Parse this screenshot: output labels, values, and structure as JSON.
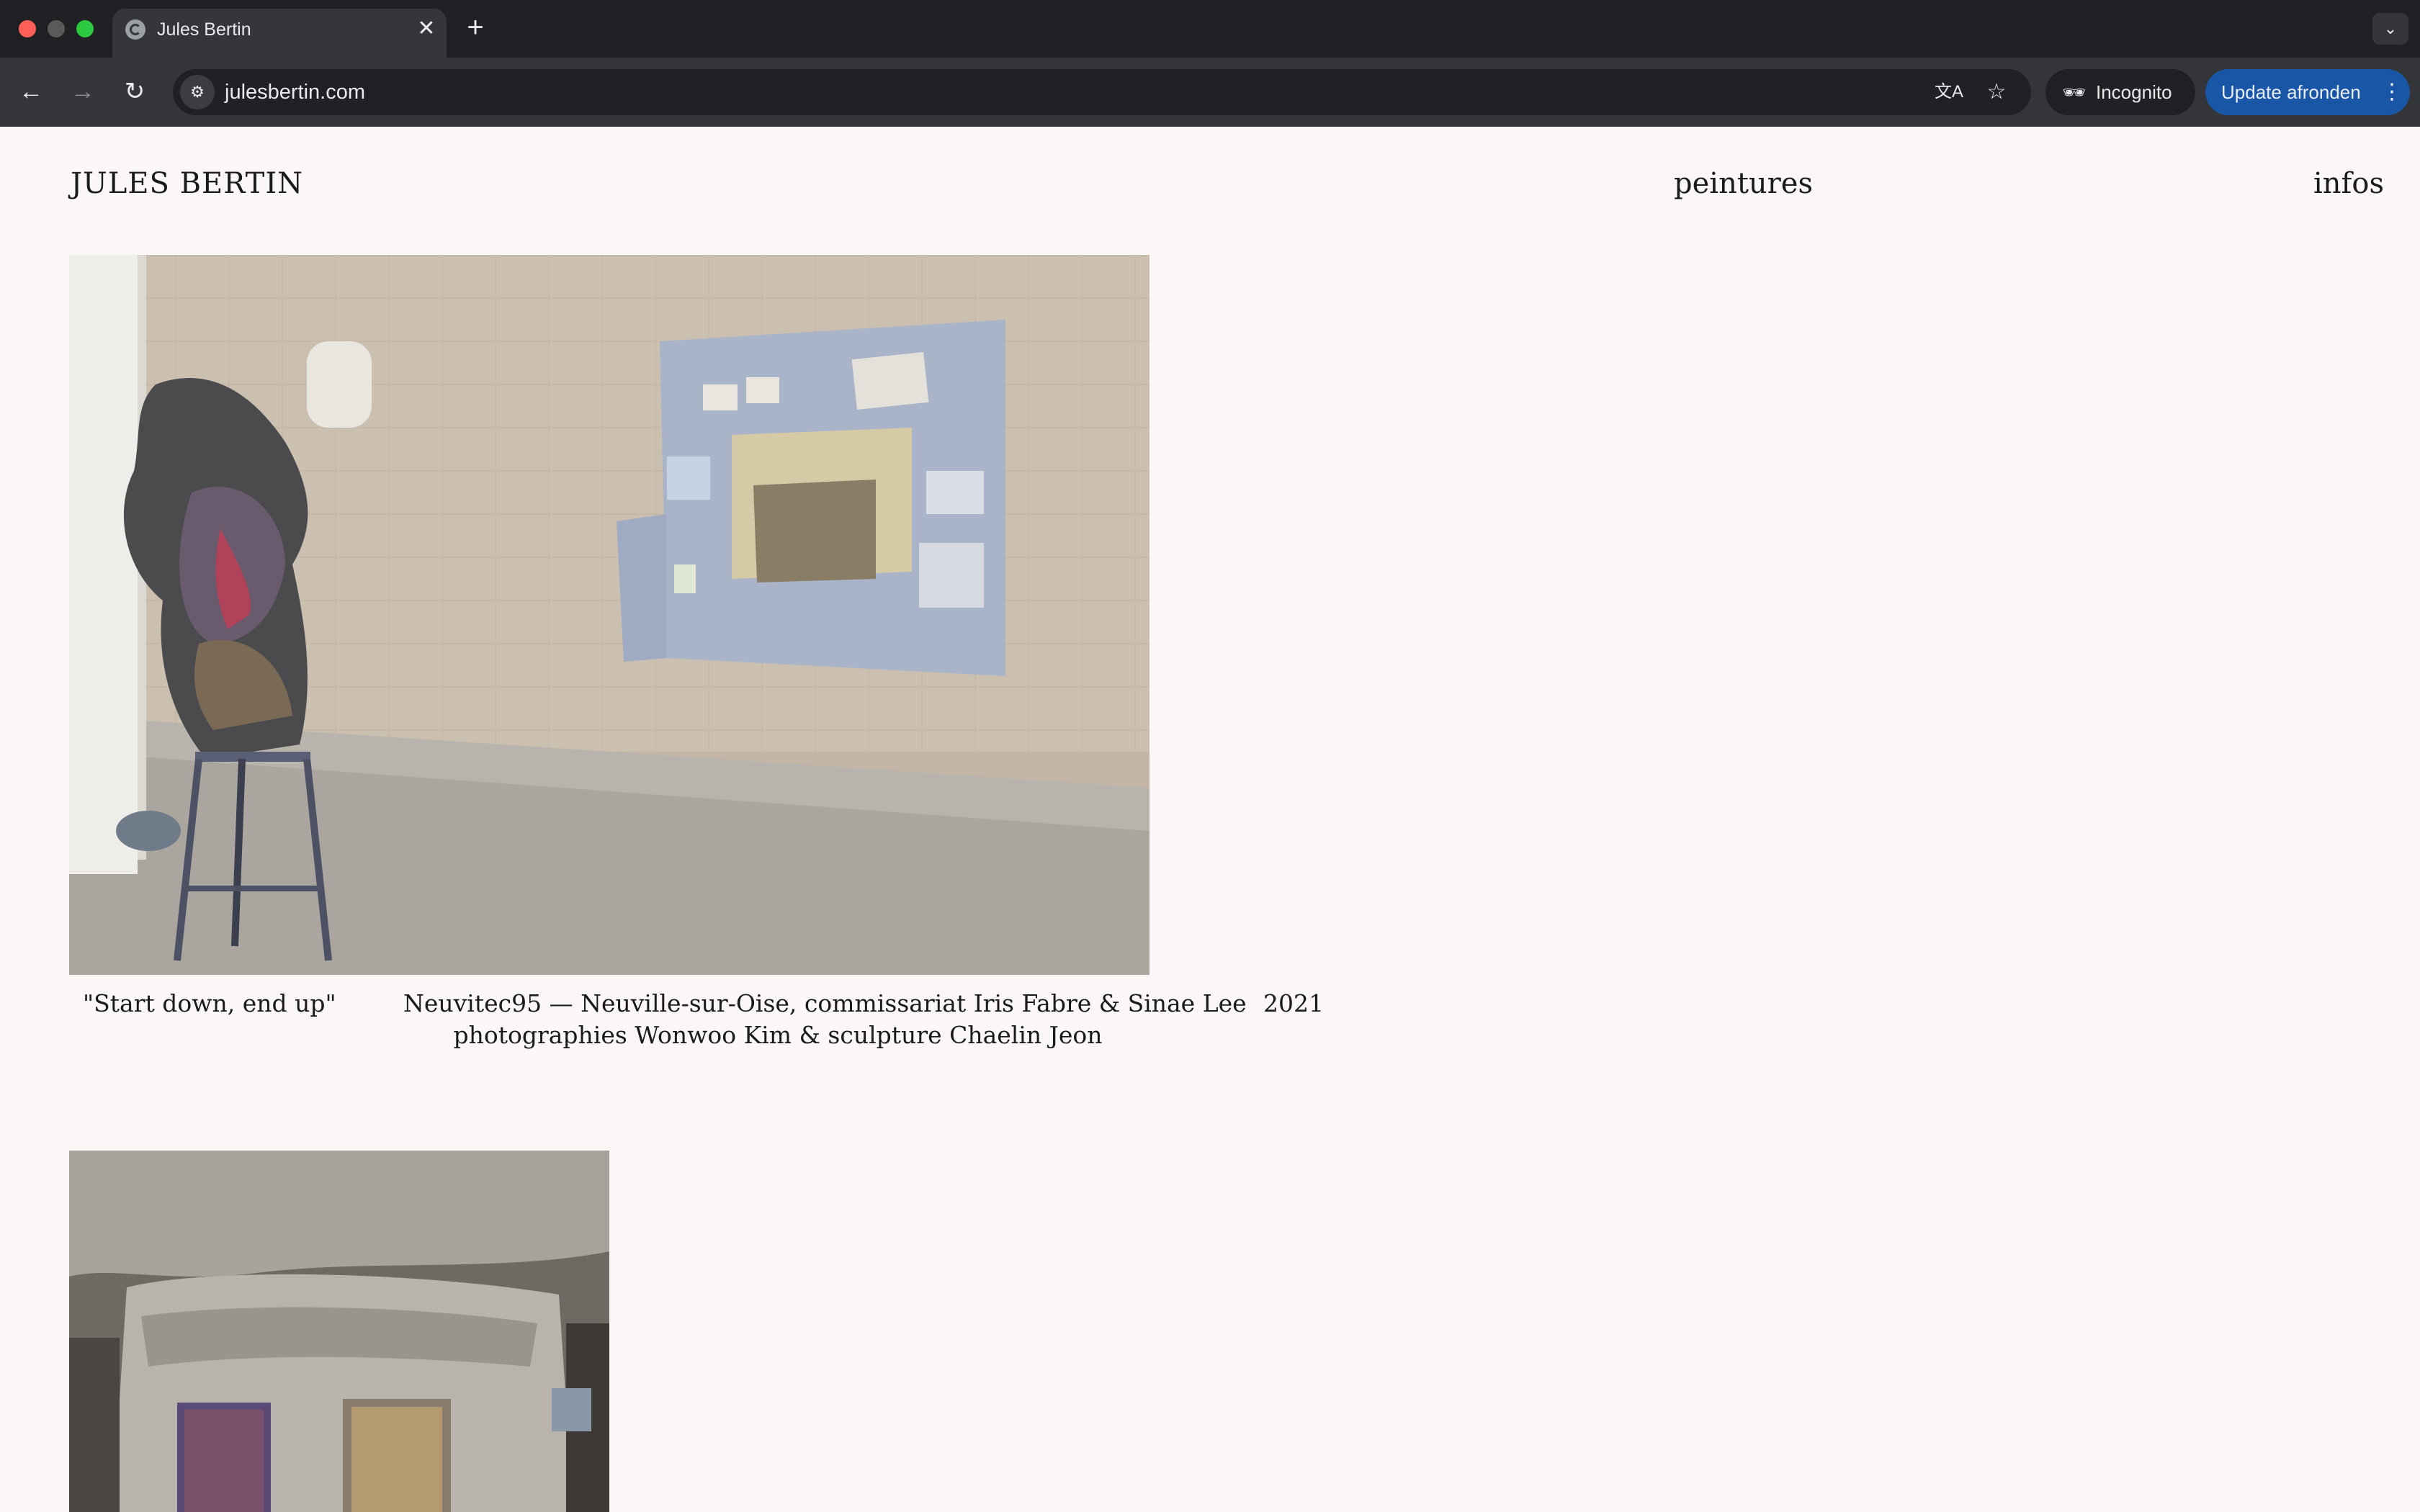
{
  "browser": {
    "tab": {
      "title": "Jules Bertin",
      "close": "✕"
    },
    "new_tab": "+",
    "tab_search": "⌄",
    "nav": {
      "back": "←",
      "forward": "→",
      "reload": "↻"
    },
    "site_info_icon": "⚙",
    "url": "julesbertin.com",
    "translate_icon": "文A",
    "star_icon": "☆",
    "incognito": {
      "icon": "🕶",
      "label": "Incognito"
    },
    "update": {
      "label": "Update afronden",
      "menu": "⋮"
    }
  },
  "site": {
    "name": "JULES BERTIN",
    "nav": {
      "peintures": "peintures",
      "infos": "infos"
    }
  },
  "works": [
    {
      "title": "\"Start down, end up\"",
      "details_line1": "Neuvitec95 — Neuville-sur-Oise, commissariat Iris Fabre & Sinae Lee",
      "details_line2": "photographies Wonwoo Kim & sculpture Chaelin Jeon",
      "year": "2021"
    }
  ],
  "colors": {
    "page_bg": "#faf7f6",
    "text": "#1b1b1b",
    "update_button": "#1a56a6"
  }
}
